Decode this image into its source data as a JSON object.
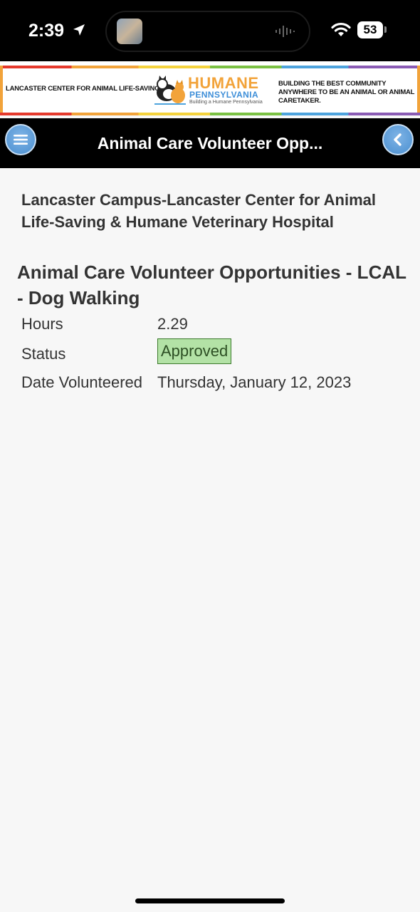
{
  "status_bar": {
    "time": "2:39",
    "battery": "53"
  },
  "banner": {
    "left_text": "LANCASTER CENTER FOR ANIMAL LIFE-SAVING",
    "logo_title": "HUMANE",
    "logo_subtitle": "PENNSYLVANIA",
    "logo_tagline": "Building a Humane Pennsylvania",
    "right_text": "BUILDING THE BEST COMMUNITY ANYWHERE TO BE AN ANIMAL OR ANIMAL CARETAKER.",
    "colors": [
      "#e5392c",
      "#f2a33a",
      "#f4d23c",
      "#7ac143",
      "#4da3dd",
      "#8a5bb4"
    ]
  },
  "nav": {
    "title": "Animal Care Volunteer Opp...",
    "menu_icon": "hamburger-menu-icon",
    "back_icon": "chevron-left-icon"
  },
  "detail": {
    "campus": "Lancaster Campus-Lancaster Center for Animal Life-Saving & Humane Veterinary Hospital",
    "opportunity": "Animal Care Volunteer Opportunities - LCAL - Dog Walking",
    "hours_label": "Hours",
    "hours_value": "2.29",
    "status_label": "Status",
    "status_value": "Approved",
    "status_color": "#b3e2a6",
    "date_label": "Date Volunteered",
    "date_value": "Thursday, January 12, 2023"
  }
}
